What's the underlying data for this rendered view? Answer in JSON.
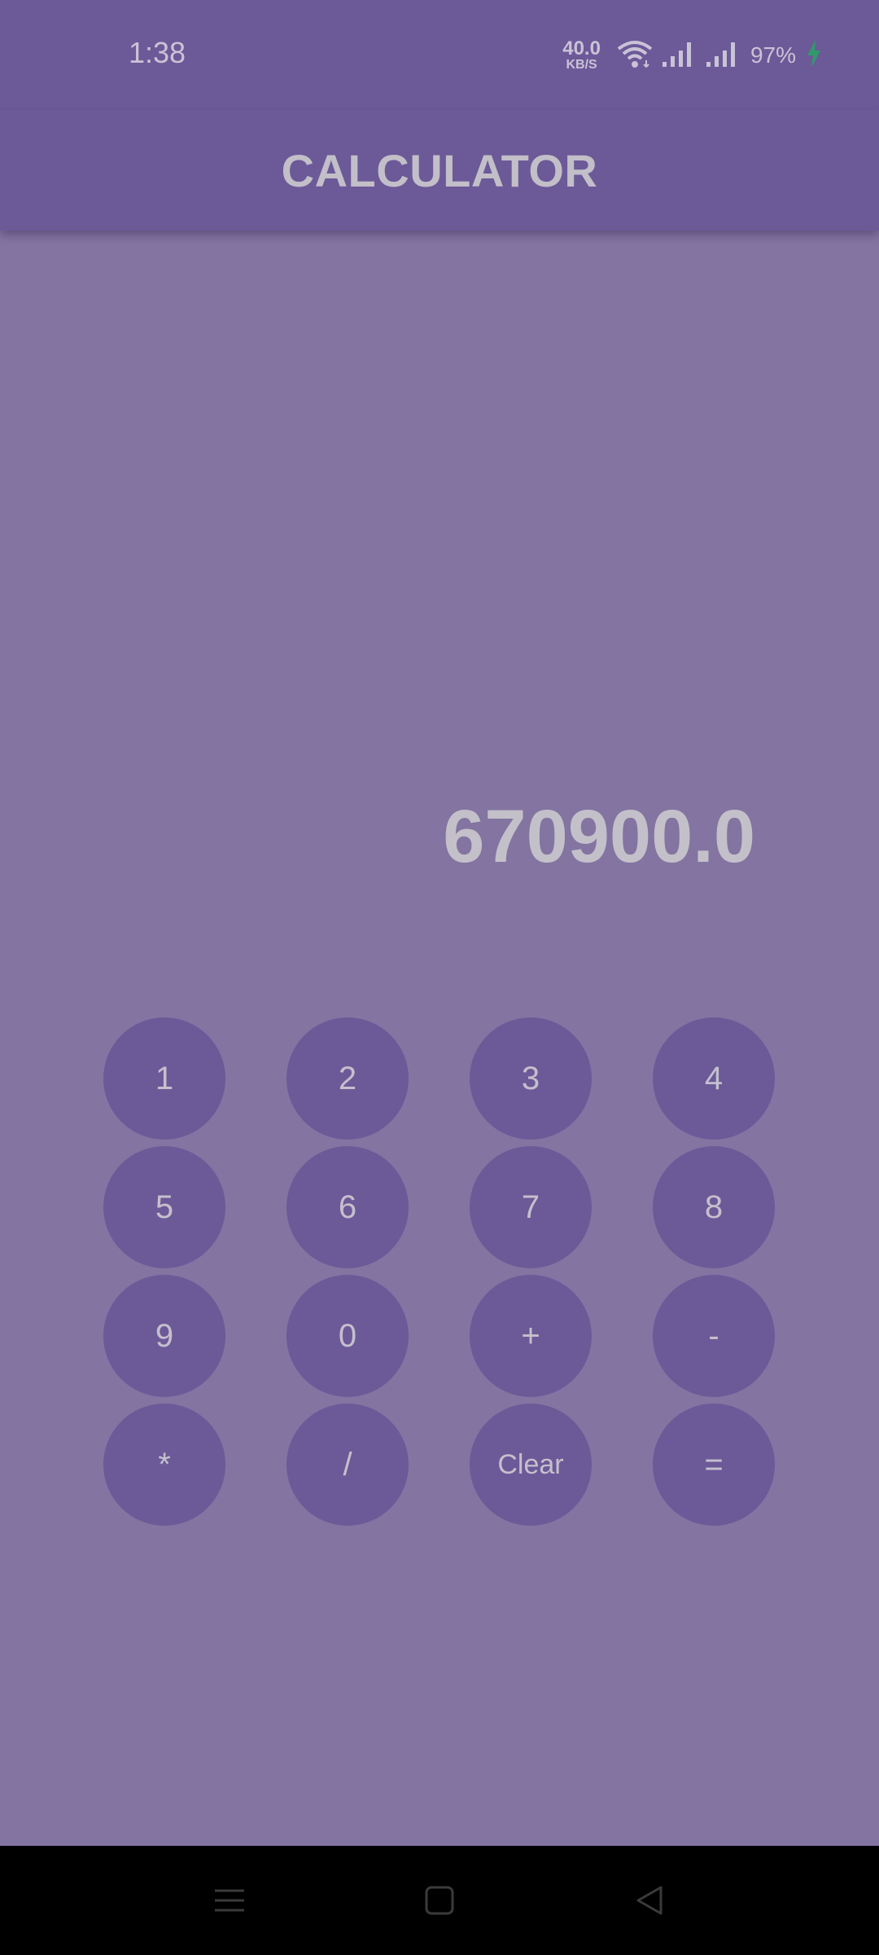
{
  "status_bar": {
    "time": "1:38",
    "net_speed_value": "40.0",
    "net_speed_unit": "KB/S",
    "battery": "97%"
  },
  "app_bar": {
    "title": "CALCULATOR"
  },
  "display": {
    "value": "670900.0"
  },
  "keypad": {
    "k1": "1",
    "k2": "2",
    "k3": "3",
    "k4": "4",
    "k5": "5",
    "k6": "6",
    "k7": "7",
    "k8": "8",
    "k9": "9",
    "k0": "0",
    "plus": "+",
    "minus": "-",
    "multiply": "*",
    "divide": "/",
    "clear": "Clear",
    "equals": "="
  },
  "nav_bar": {
    "menu_icon": "menu-icon",
    "home_icon": "home-icon",
    "back_icon": "back-icon"
  },
  "colors": {
    "primary": "#6c5998",
    "background": "#8374a1",
    "text": "#c2bfc8"
  }
}
